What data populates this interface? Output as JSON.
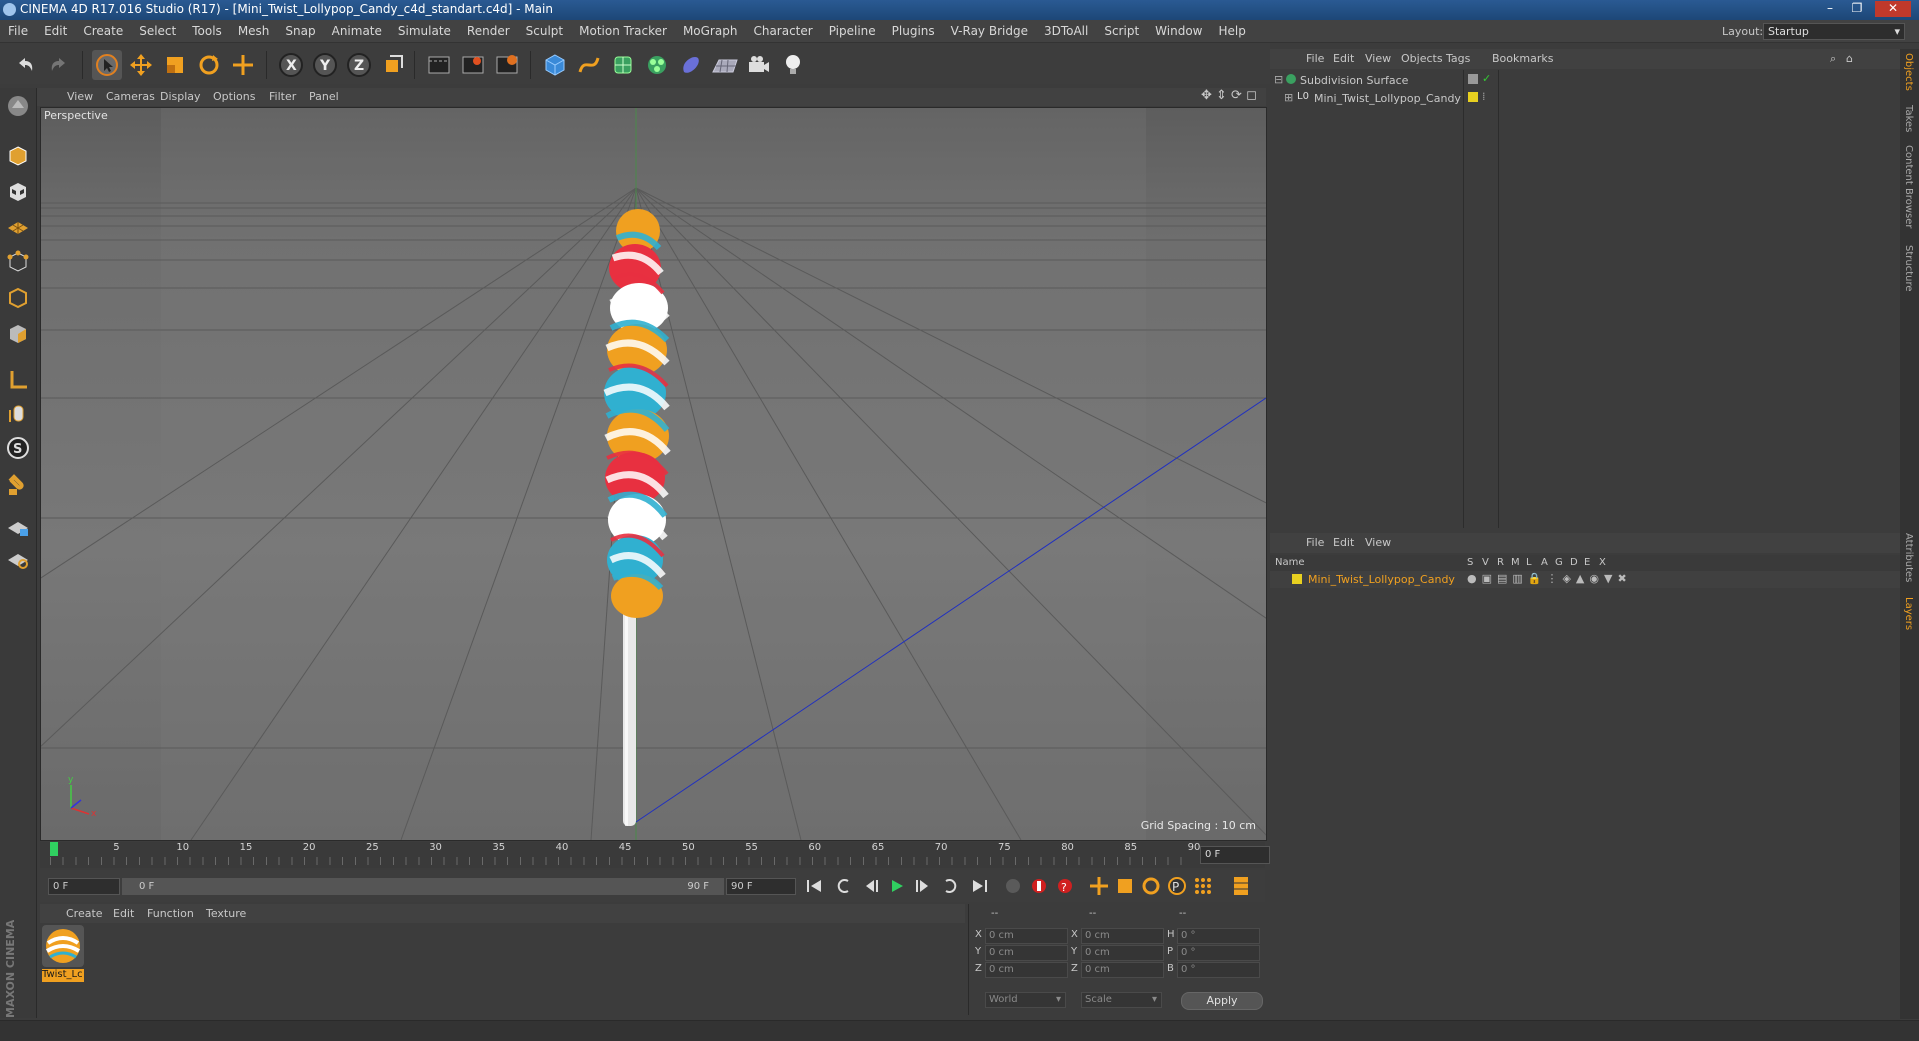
{
  "window": {
    "title": "CINEMA 4D R17.016 Studio (R17) - [Mini_Twist_Lollypop_Candy_c4d_standart.c4d] - Main",
    "controls": [
      "–",
      "❐",
      "✕"
    ]
  },
  "menubar": {
    "items": [
      "File",
      "Edit",
      "Create",
      "Select",
      "Tools",
      "Mesh",
      "Snap",
      "Animate",
      "Simulate",
      "Render",
      "Sculpt",
      "Motion Tracker",
      "MoGraph",
      "Character",
      "Pipeline",
      "Plugins",
      "V-Ray Bridge",
      "3DToAll",
      "Script",
      "Window",
      "Help"
    ],
    "layout_label": "Layout:",
    "layout_value": "Startup"
  },
  "toolbar": {
    "icons": [
      "undo-icon",
      "redo-icon",
      "select-pointer-icon",
      "move-icon",
      "scale-icon",
      "rotate-icon",
      "live-selection-icon",
      "x-axis-icon",
      "y-axis-icon",
      "z-axis-icon",
      "world-coordinates-icon",
      "render-view-icon",
      "render-picture-viewer-icon",
      "render-settings-icon",
      "cube-icon",
      "pen-spline-icon",
      "subdivision-icon",
      "cloner-icon",
      "deformer-icon",
      "floor-icon",
      "camera-icon",
      "light-icon"
    ],
    "axis_x": "X",
    "axis_y": "Y",
    "axis_z": "Z"
  },
  "left_tools": [
    "make-editable-icon",
    "model-mode-icon",
    "texture-mode-icon",
    "workplane-icon",
    "points-mode-icon",
    "edges-mode-icon",
    "polygons-mode-icon",
    "axis-mode-icon",
    "tweak-icon",
    "snap-icon",
    "magnet-icon",
    "lock-workplane-icon",
    "solo-icon"
  ],
  "viewport": {
    "menu": [
      "View",
      "Cameras",
      "Display",
      "Options",
      "Filter",
      "Panel"
    ],
    "camera_label": "Perspective",
    "grid_spacing": "Grid Spacing : 10 cm"
  },
  "timeline": {
    "ticks": [
      "0",
      "5",
      "10",
      "15",
      "20",
      "25",
      "30",
      "35",
      "40",
      "45",
      "50",
      "55",
      "60",
      "65",
      "70",
      "75",
      "80",
      "85",
      "90"
    ],
    "current_frame": "0 F",
    "start_field": "0 F",
    "range_start": "0 F",
    "range_end": "90 F",
    "end_field": "90 F"
  },
  "material_manager": {
    "menu": [
      "Create",
      "Edit",
      "Function",
      "Texture"
    ],
    "materials": [
      {
        "name": "Twist_Lc"
      }
    ]
  },
  "coordinates": {
    "header": [
      "--",
      "--",
      "--"
    ],
    "rows": [
      {
        "axis": "X",
        "pos": "0 cm",
        "axis2": "X",
        "size": "0 cm",
        "axis3": "H",
        "rot": "0 °"
      },
      {
        "axis": "Y",
        "pos": "0 cm",
        "axis2": "Y",
        "size": "0 cm",
        "axis3": "P",
        "rot": "0 °"
      },
      {
        "axis": "Z",
        "pos": "0 cm",
        "axis2": "Z",
        "size": "0 cm",
        "axis3": "B",
        "rot": "0 °"
      }
    ],
    "mode_world": "World",
    "mode_scale": "Scale",
    "apply": "Apply"
  },
  "object_manager": {
    "menu": [
      "File",
      "Edit",
      "View",
      "Objects",
      "Tags",
      "Bookmarks"
    ],
    "objects": [
      {
        "name": "Subdivision Surface",
        "color": "#888888"
      },
      {
        "name": "Mini_Twist_Lollypop_Candy",
        "color": "#e8d020"
      }
    ]
  },
  "layer_manager": {
    "menu": [
      "File",
      "Edit",
      "View"
    ],
    "headers": [
      "Name",
      "S",
      "V",
      "R",
      "M",
      "L",
      "A",
      "G",
      "D",
      "E",
      "X"
    ],
    "layers": [
      {
        "name": "Mini_Twist_Lollypop_Candy",
        "color": "#e8d020"
      }
    ]
  },
  "right_tabs": [
    "Objects",
    "Takes",
    "Content Browser",
    "Structure",
    "Attributes",
    "Layers"
  ],
  "branding": "MAXON CINEMA 4D",
  "colors": {
    "accent_orange": "#f0a020",
    "axis_blue": "#2030c0",
    "timeline_green": "#30d060"
  }
}
